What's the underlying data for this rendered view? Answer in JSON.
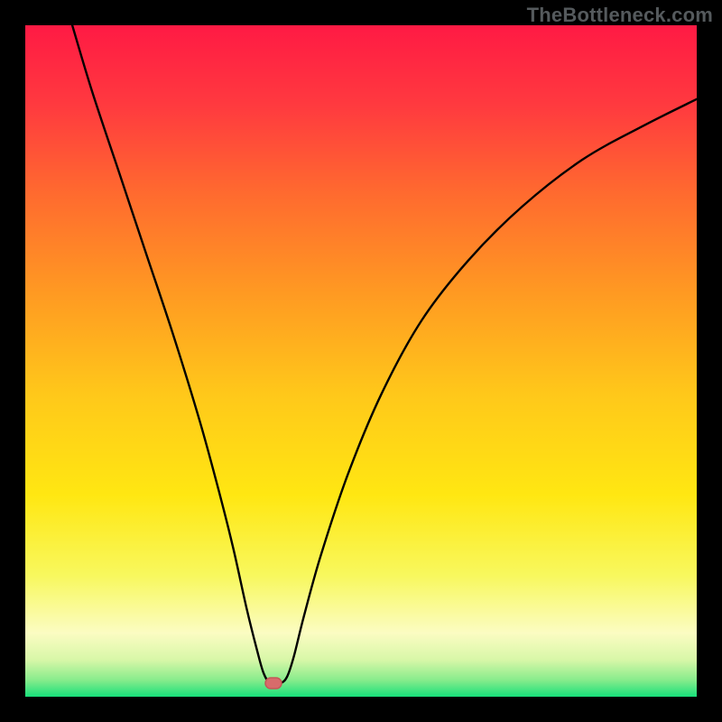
{
  "watermark": "TheBottleneck.com",
  "colors": {
    "frame": "#000000",
    "watermark": "#555a5d",
    "curve": "#000000",
    "marker_fill": "#d86b6b",
    "marker_stroke": "#c45858",
    "gradient_stops": [
      {
        "offset": 0.0,
        "color": "#ff1a44"
      },
      {
        "offset": 0.12,
        "color": "#ff3a3f"
      },
      {
        "offset": 0.25,
        "color": "#ff6a2f"
      },
      {
        "offset": 0.4,
        "color": "#ff9a22"
      },
      {
        "offset": 0.55,
        "color": "#ffc81a"
      },
      {
        "offset": 0.7,
        "color": "#ffe712"
      },
      {
        "offset": 0.82,
        "color": "#f8f85e"
      },
      {
        "offset": 0.905,
        "color": "#fbfcc2"
      },
      {
        "offset": 0.945,
        "color": "#d8f7a8"
      },
      {
        "offset": 0.975,
        "color": "#88ec8c"
      },
      {
        "offset": 1.0,
        "color": "#17e07a"
      }
    ]
  },
  "chart_data": {
    "type": "line",
    "title": "",
    "xlabel": "",
    "ylabel": "",
    "xlim": [
      0,
      100
    ],
    "ylim": [
      0,
      100
    ],
    "marker": {
      "x": 37,
      "y": 2
    },
    "curve_points": [
      {
        "x": 7,
        "y": 100
      },
      {
        "x": 10,
        "y": 90
      },
      {
        "x": 14,
        "y": 78
      },
      {
        "x": 18,
        "y": 66
      },
      {
        "x": 22,
        "y": 54
      },
      {
        "x": 26,
        "y": 41
      },
      {
        "x": 29,
        "y": 30
      },
      {
        "x": 31,
        "y": 22
      },
      {
        "x": 33,
        "y": 13
      },
      {
        "x": 34.5,
        "y": 7
      },
      {
        "x": 35.5,
        "y": 3.5
      },
      {
        "x": 36.5,
        "y": 2
      },
      {
        "x": 38,
        "y": 2
      },
      {
        "x": 39,
        "y": 3
      },
      {
        "x": 40,
        "y": 6
      },
      {
        "x": 41.5,
        "y": 12
      },
      {
        "x": 44,
        "y": 21
      },
      {
        "x": 48,
        "y": 33
      },
      {
        "x": 53,
        "y": 45
      },
      {
        "x": 59,
        "y": 56
      },
      {
        "x": 66,
        "y": 65
      },
      {
        "x": 74,
        "y": 73
      },
      {
        "x": 83,
        "y": 80
      },
      {
        "x": 92,
        "y": 85
      },
      {
        "x": 100,
        "y": 89
      }
    ]
  }
}
